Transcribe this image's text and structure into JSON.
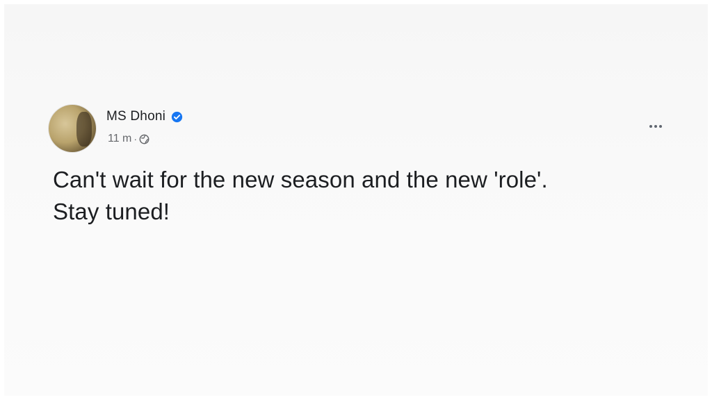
{
  "post": {
    "author": {
      "name": "MS Dhoni",
      "verified": true,
      "avatar_icon": "profile-photo"
    },
    "meta": {
      "time": "11 m",
      "separator": "·",
      "audience_icon": "globe-icon"
    },
    "text_lines": [
      "Can't wait for the new season and the new 'role'.",
      "Stay tuned!"
    ],
    "more_icon": "more-options-icon"
  },
  "colors": {
    "verified_badge": "#1877f2",
    "text_primary": "#1c1e21",
    "text_secondary": "#65676b",
    "background": "#f8f8f8"
  }
}
